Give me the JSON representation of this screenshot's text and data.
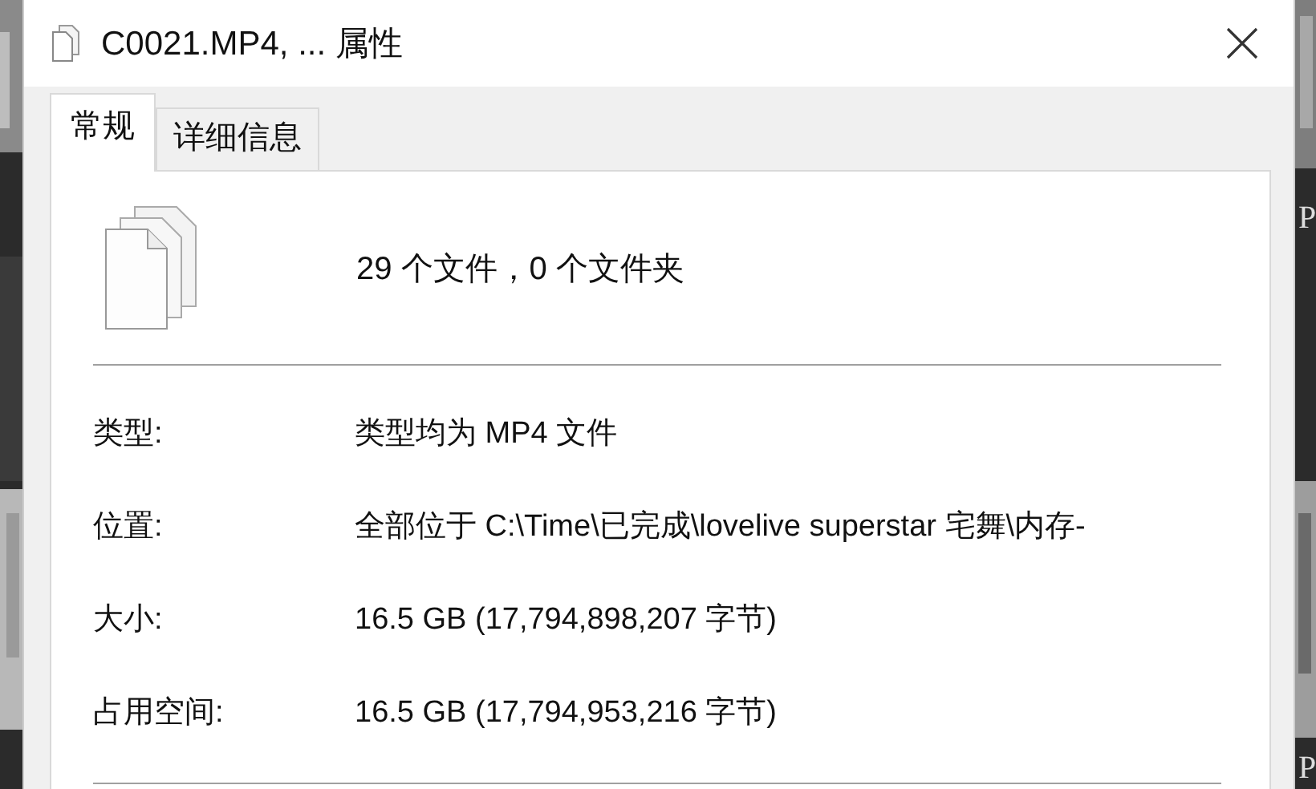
{
  "window": {
    "title": "C0021.MP4, ... 属性"
  },
  "tabs": [
    {
      "label": "常规",
      "selected": true
    },
    {
      "label": "详细信息",
      "selected": false
    }
  ],
  "summary": "29 个文件，0 个文件夹",
  "properties": [
    {
      "label": "类型:",
      "value": "类型均为 MP4 文件"
    },
    {
      "label": "位置:",
      "value": "全部位于 C:\\Time\\已完成\\lovelive superstar 宅舞\\内存-"
    },
    {
      "label": "大小:",
      "value": "16.5 GB (17,794,898,207 字节)"
    },
    {
      "label": "占用空间:",
      "value": "16.5 GB (17,794,953,216 字节)"
    }
  ],
  "background_labels": [
    "P",
    "P"
  ]
}
